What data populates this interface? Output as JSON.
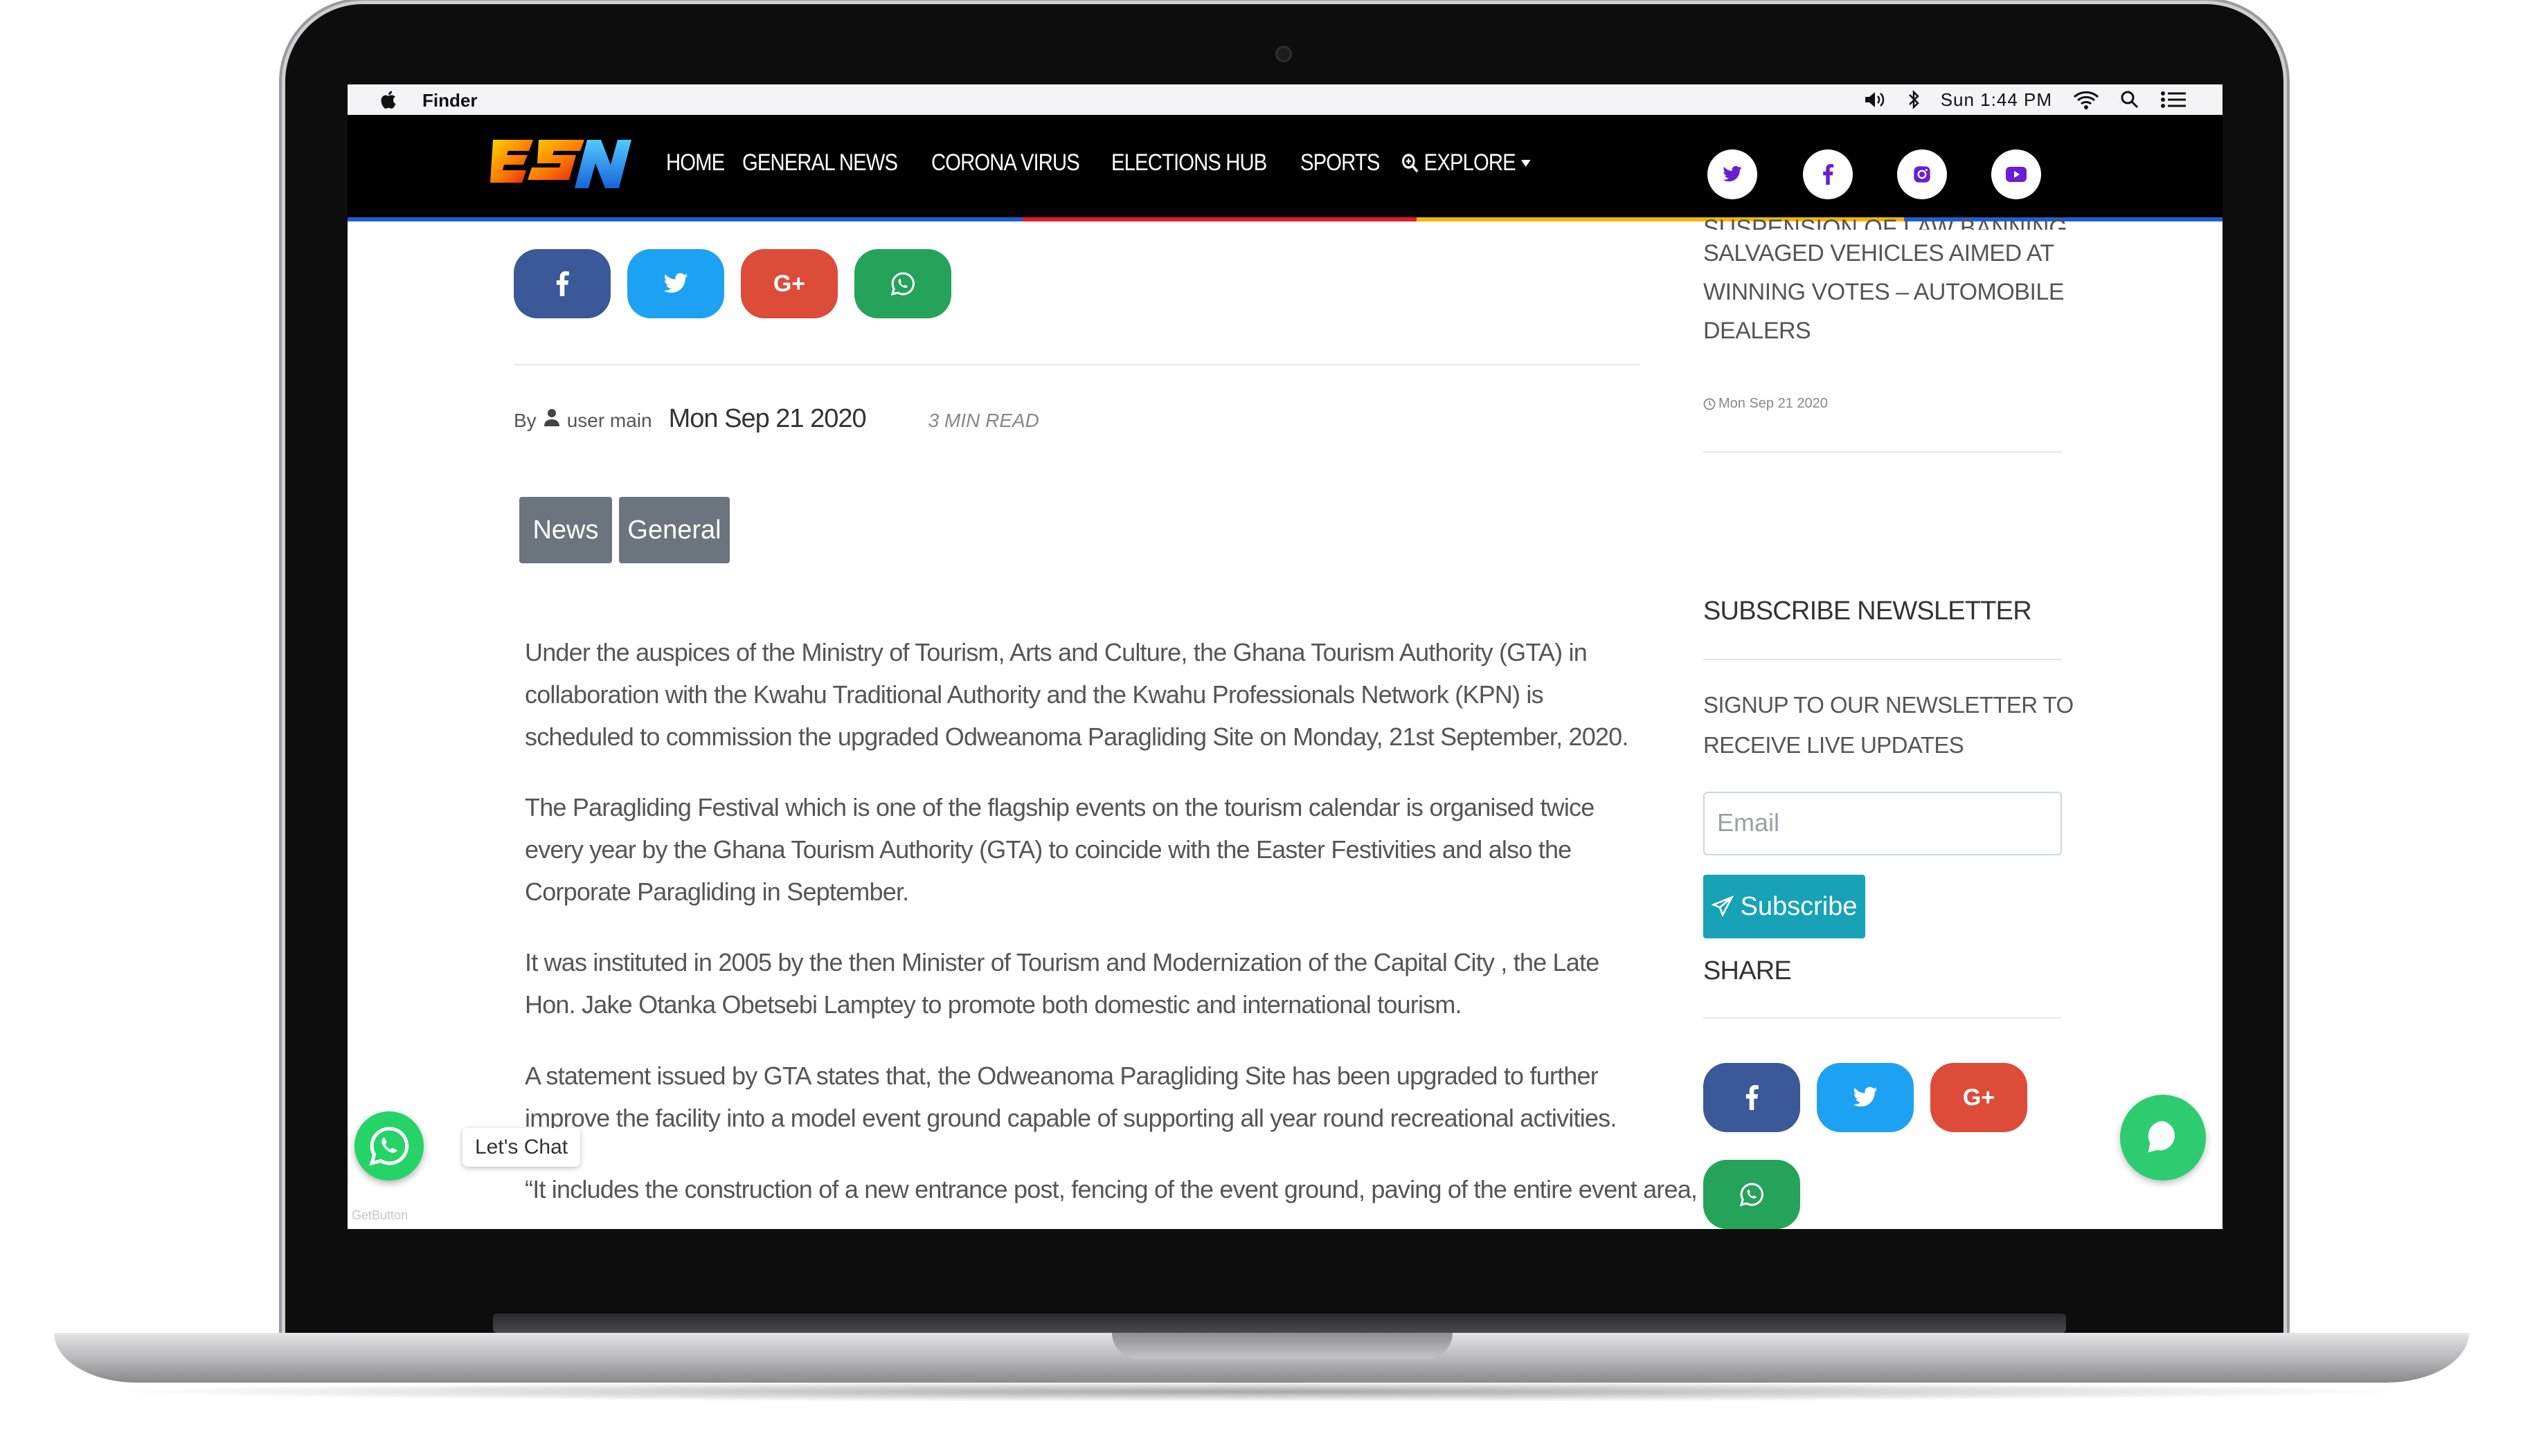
{
  "menubar": {
    "app_name": "Finder",
    "clock": "Sun 1:44 PM"
  },
  "header": {
    "logo_text": "ESN",
    "nav": [
      "HOME",
      "GENERAL NEWS",
      "CORONA VIRUS",
      "ELECTIONS HUB",
      "SPORTS"
    ],
    "explore_label": "EXPLORE",
    "social_icons": [
      "twitter-icon",
      "facebook-icon",
      "instagram-icon",
      "youtube-icon"
    ],
    "social_icon_color": "#6a1fd1",
    "stripe_colors": [
      "#1f5fd1",
      "#e31b23",
      "#f5b400",
      "#1f5fd1"
    ]
  },
  "share": {
    "buttons": [
      {
        "name": "facebook",
        "glyph": "f",
        "color": "#3b5998"
      },
      {
        "name": "twitter",
        "glyph": "t",
        "color": "#1da1f2"
      },
      {
        "name": "google-plus",
        "glyph": "G+",
        "color": "#dd4b39"
      },
      {
        "name": "whatsapp",
        "glyph": "w",
        "color": "#25a35a"
      }
    ]
  },
  "article": {
    "by_label": "By",
    "author": "user main",
    "date": "Mon Sep 21 2020",
    "read_time": "3 MIN READ",
    "tags": [
      "News",
      "General"
    ],
    "paragraphs": [
      "Under the auspices of the Ministry of Tourism, Arts and Culture, the Ghana Tourism Authority (GTA) in collaboration with the Kwahu Traditional Authority and the Kwahu Professionals Network (KPN) is scheduled to commission the upgraded Odweanoma Paragliding Site on Monday, 21st September, 2020.",
      "The Paragliding Festival which is one of the flagship events on the tourism calendar is organised twice every year by the Ghana Tourism Authority (GTA) to coincide with the Easter Festivities and also the Corporate Paragliding in September.",
      "It was instituted in 2005 by the then Minister of Tourism and Modernization of the Capital City , the Late Hon. Jake Otanka Obetsebi Lamptey to promote both domestic and international tourism.",
      "A statement issued by GTA states that, the Odweanoma Paragliding Site has been upgraded to further improve the facility into a model event ground capable of supporting all year round recreational activities.",
      "“It includes the construction of a new entrance post, fencing of the event ground, paving of the entire event area,"
    ]
  },
  "sidebar": {
    "related": {
      "title_partial": "SUSPENSION OF LAW BANNING",
      "title_lines": [
        "SALVAGED VEHICLES AIMED AT",
        "WINNING VOTES – AUTOMOBILE",
        "DEALERS"
      ],
      "date": "Mon Sep 21 2020"
    },
    "newsletter": {
      "heading": "SUBSCRIBE NEWSLETTER",
      "description_lines": [
        "SIGNUP TO OUR NEWSLETTER TO",
        "RECEIVE LIVE UPDATES"
      ],
      "email_placeholder": "Email",
      "subscribe_label": "Subscribe"
    },
    "share_heading": "SHARE"
  },
  "widgets": {
    "chat_label": "Let's Chat",
    "getbutton_label": "GetButton"
  }
}
